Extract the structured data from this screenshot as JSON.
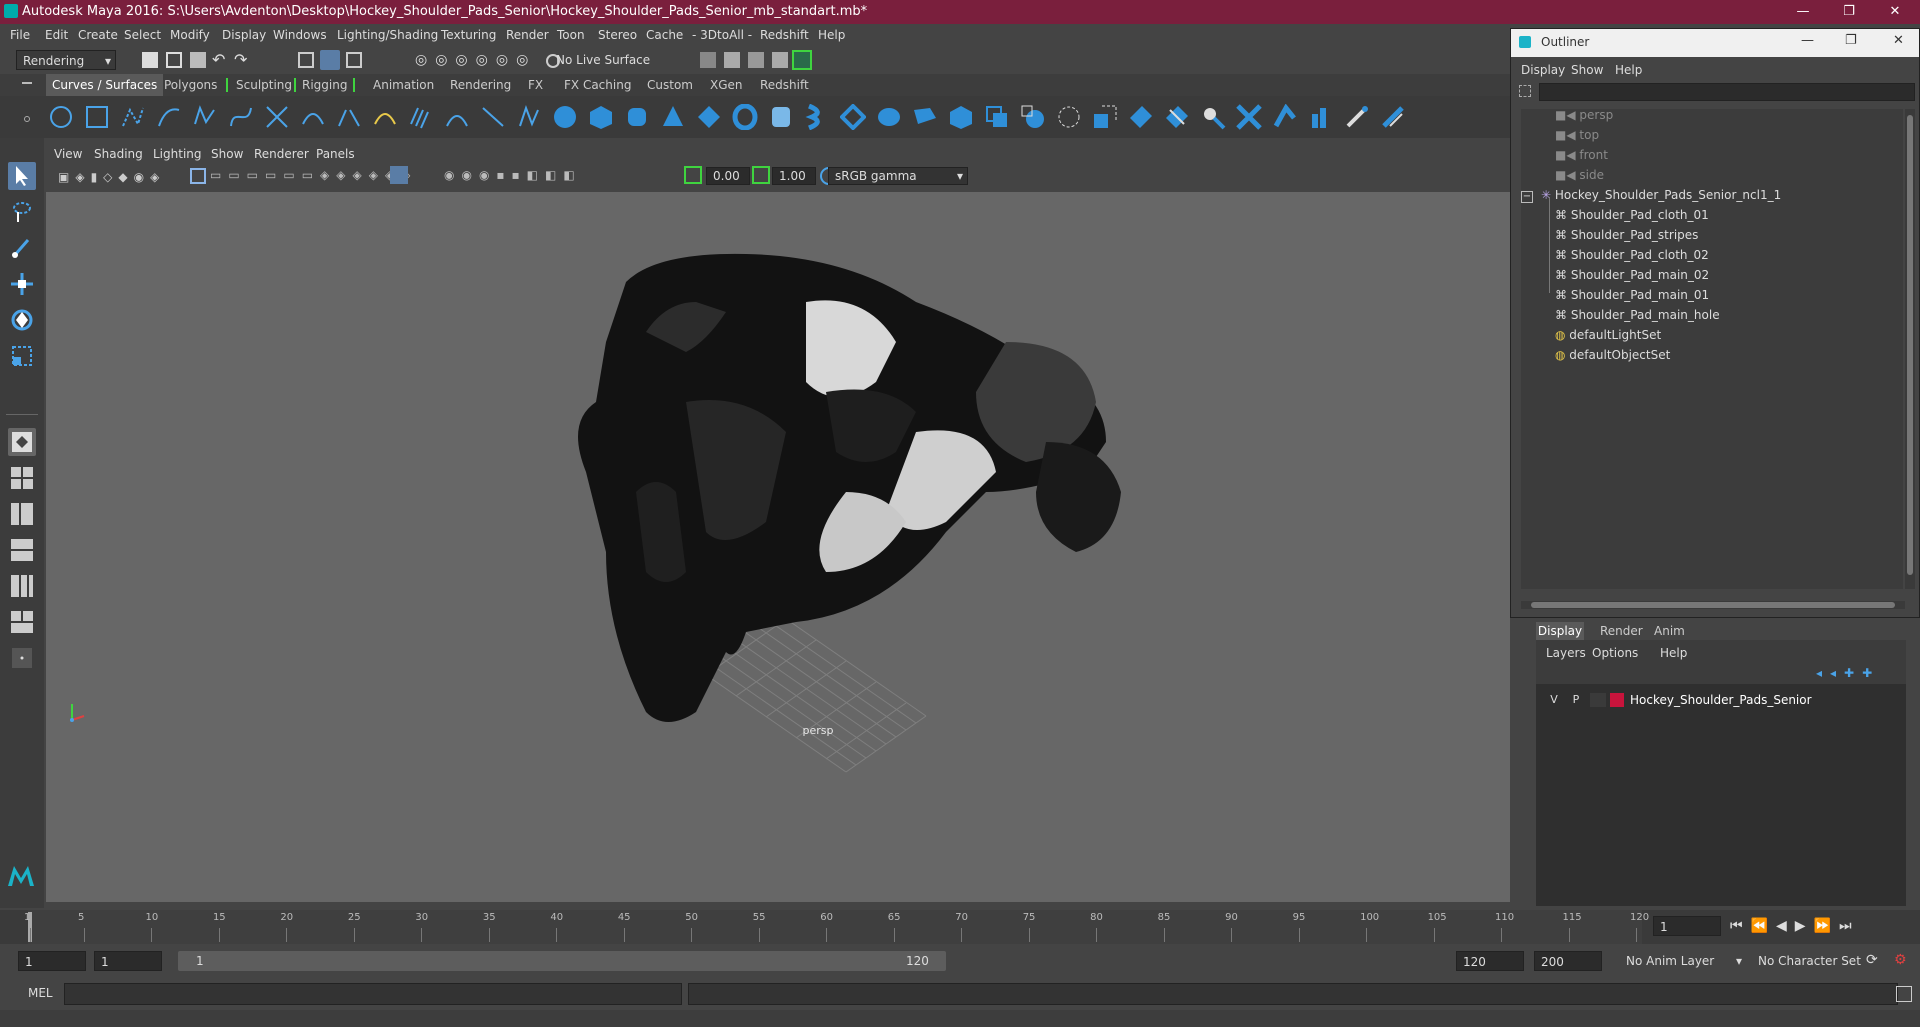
{
  "window": {
    "title": "Autodesk Maya 2016: S:\\Users\\Avdenton\\Desktop\\Hockey_Shoulder_Pads_Senior\\Hockey_Shoulder_Pads_Senior_mb_standart.mb*",
    "minimize": "—",
    "maximize": "❐",
    "close": "✕"
  },
  "menu": [
    "File",
    "Edit",
    "Create",
    "Select",
    "Modify",
    "Display",
    "Windows",
    "Lighting/Shading",
    "Texturing",
    "Render",
    "Toon",
    "Stereo",
    "Cache",
    "- 3DtoAll -",
    "Redshift",
    "Help"
  ],
  "status_line": {
    "mode": "Rendering",
    "live_surface": "No Live Surface"
  },
  "shelf_tabs": [
    "Curves / Surfaces",
    "Polygons",
    "Sculpting",
    "Rigging",
    "Animation",
    "Rendering",
    "FX",
    "FX Caching",
    "Custom",
    "XGen",
    "Redshift"
  ],
  "active_shelf_tab": "Curves / Surfaces",
  "panel_menu": [
    "View",
    "Shading",
    "Lighting",
    "Show",
    "Renderer",
    "Panels"
  ],
  "panel_tools": {
    "exposure": "0.00",
    "gamma": "1.00",
    "color_space": "sRGB gamma"
  },
  "viewport": {
    "camera_label": "persp",
    "axis_y": "y",
    "axis_x": "x"
  },
  "outliner": {
    "title": "Outliner",
    "menu": [
      "Display",
      "Show",
      "Help"
    ],
    "items": [
      {
        "label": "persp",
        "type": "camera",
        "indent": 0,
        "dim": true
      },
      {
        "label": "top",
        "type": "camera",
        "indent": 0,
        "dim": true
      },
      {
        "label": "front",
        "type": "camera",
        "indent": 0,
        "dim": true
      },
      {
        "label": "side",
        "type": "camera",
        "indent": 0,
        "dim": true
      },
      {
        "label": "Hockey_Shoulder_Pads_Senior_ncl1_1",
        "type": "group",
        "indent": 0,
        "dim": false
      },
      {
        "label": "Shoulder_Pad_cloth_01",
        "type": "mesh",
        "indent": 1,
        "dim": false
      },
      {
        "label": "Shoulder_Pad_stripes",
        "type": "mesh",
        "indent": 1,
        "dim": false
      },
      {
        "label": "Shoulder_Pad_cloth_02",
        "type": "mesh",
        "indent": 1,
        "dim": false
      },
      {
        "label": "Shoulder_Pad_main_02",
        "type": "mesh",
        "indent": 1,
        "dim": false
      },
      {
        "label": "Shoulder_Pad_main_01",
        "type": "mesh",
        "indent": 1,
        "dim": false
      },
      {
        "label": "Shoulder_Pad_main_hole",
        "type": "mesh",
        "indent": 1,
        "dim": false
      },
      {
        "label": "defaultLightSet",
        "type": "set",
        "indent": 0,
        "dim": false
      },
      {
        "label": "defaultObjectSet",
        "type": "set",
        "indent": 0,
        "dim": false
      }
    ]
  },
  "layer_editor": {
    "tabs": [
      "Display",
      "Render",
      "Anim"
    ],
    "menu": [
      "Layers",
      "Options",
      "Help"
    ],
    "layer": {
      "v": "V",
      "p": "P",
      "name": "Hockey_Shoulder_Pads_Senior",
      "color": "#c8143c"
    }
  },
  "timeline": {
    "ticks": [
      "1",
      "5",
      "10",
      "15",
      "20",
      "25",
      "30",
      "35",
      "40",
      "45",
      "50",
      "55",
      "60",
      "65",
      "70",
      "75",
      "80",
      "85",
      "90",
      "95",
      "100",
      "105",
      "110",
      "115",
      "120"
    ],
    "current_frame": "1"
  },
  "range": {
    "start": "1",
    "playback_start": "1",
    "slider_start": "1",
    "slider_end": "120",
    "playback_end": "120",
    "end": "200",
    "anim_layer": "No Anim Layer",
    "character_set": "No Character Set"
  },
  "command_line": {
    "label": "MEL"
  },
  "colors": {
    "title_bar": "#7a1f3d",
    "accent_green": "#3fd43f",
    "icon_blue": "#2f8fd8",
    "layer_color": "#c8143c"
  }
}
